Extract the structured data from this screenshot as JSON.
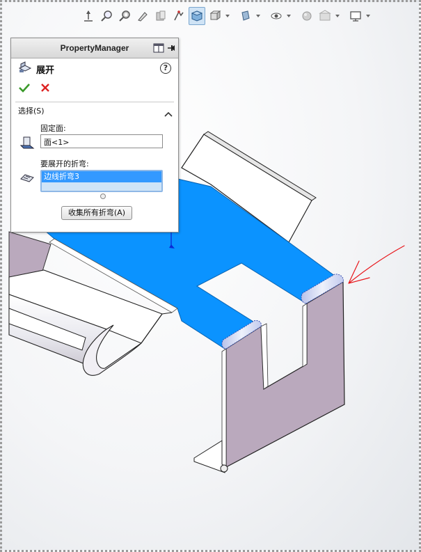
{
  "toolbar": {
    "items": [
      {
        "icon": "view-orientation-icon"
      },
      {
        "icon": "zoom-to-fit-icon"
      },
      {
        "icon": "zoom-to-area-icon"
      },
      {
        "icon": "previous-view-icon"
      },
      {
        "icon": "section-view-icon"
      },
      {
        "icon": "dynamic-annotation-icon"
      },
      {
        "icon": "view-3d-icon",
        "active": true
      },
      {
        "icon": "view-orientation-dropdown-icon"
      },
      {
        "icon": "display-style-icon"
      },
      {
        "icon": "hide-show-items-icon"
      },
      {
        "icon": "edit-appearance-icon"
      },
      {
        "icon": "apply-scene-icon"
      },
      {
        "icon": "view-settings-icon"
      }
    ]
  },
  "property_manager": {
    "header_title": "PropertyManager",
    "feature_title": "展开",
    "help_symbol": "?",
    "section_title": "选择(S)",
    "fixed_face_label": "固定面:",
    "fixed_face_value": "面<1>",
    "bends_label": "要展开的折弯:",
    "bends_items": [
      "边线折弯3"
    ],
    "collect_button": "收集所有折弯(A)"
  },
  "colors": {
    "selected_face": "#0b93ff",
    "part_side": "#baa9bd",
    "bend_highlight": "#cfd6f0",
    "annotation_arrow": "#e8161b"
  }
}
